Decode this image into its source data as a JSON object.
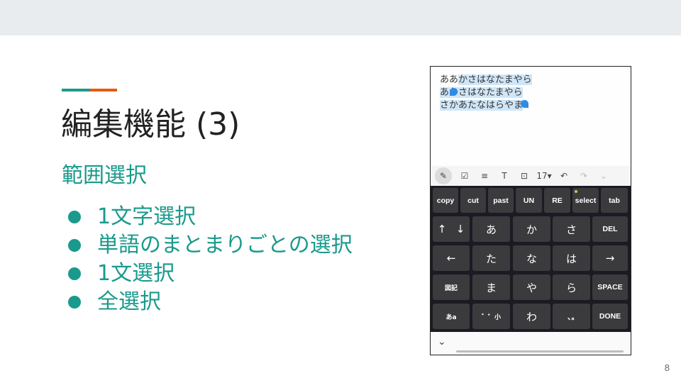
{
  "slide": {
    "title": "編集機能 (3)",
    "subtitle": "範囲選択",
    "bullets": [
      "1文字選択",
      "単語のまとまりごとの選択",
      "1文選択",
      "全選択"
    ],
    "page_number": "8"
  },
  "editor": {
    "line1_plain": "ああ",
    "line1_selected": "かさはなたまやら",
    "line2_selected": "あか",
    "line2_plain": "さはなたまやら",
    "line3_selected": "さかあたなはらやま",
    "toolbar": {
      "font_size": "17▾"
    }
  },
  "keyboard": {
    "row1": [
      "copy",
      "cut",
      "past",
      "UN",
      "RE",
      "select",
      "tab"
    ],
    "row2": [
      "↑",
      "↓",
      "あ",
      "か",
      "さ",
      "DEL"
    ],
    "row3": [
      "←",
      "た",
      "な",
      "は",
      "→"
    ],
    "row4": [
      "図記",
      "ま",
      "や",
      "ら",
      "SPACE"
    ],
    "row5": [
      "あa",
      "゛゜小",
      "わ",
      "､｡",
      "DONE"
    ]
  },
  "colors": {
    "accent_teal": "#1a9a8c",
    "accent_orange": "#e65a0f",
    "selection": "#cfe6f8",
    "handle": "#2f8be6",
    "keyboard_bg": "#1c1a22",
    "key_bg": "#3b3b3e"
  }
}
